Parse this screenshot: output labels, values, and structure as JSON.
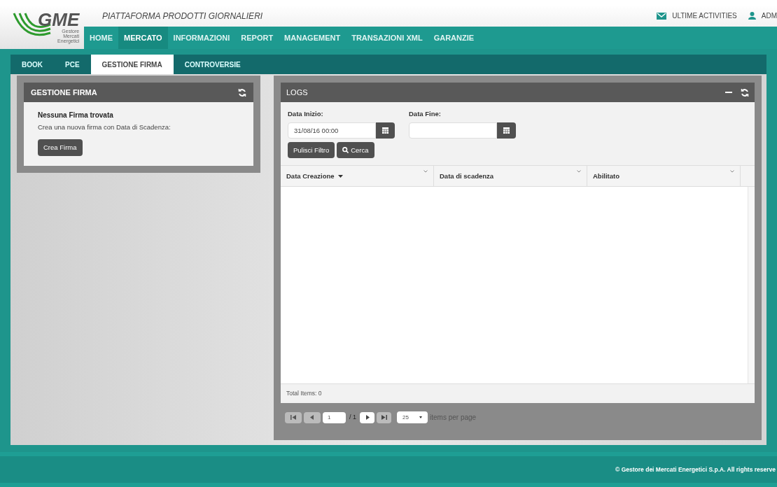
{
  "header": {
    "logo": {
      "name": "GME",
      "subtitle": [
        "Gestore",
        "Mercati",
        "Energetici"
      ]
    },
    "title": "PIATTAFORMA PRODOTTI GIORNALIERI",
    "links": [
      {
        "kind": "mail",
        "label": "ULTIME ACTIVITIES"
      },
      {
        "kind": "user",
        "label": "ADM"
      }
    ]
  },
  "nav": [
    {
      "label": "HOME",
      "selected": false
    },
    {
      "label": "MERCATO",
      "selected": true
    },
    {
      "label": "INFORMAZIONI",
      "selected": false
    },
    {
      "label": "REPORT",
      "selected": false
    },
    {
      "label": "MANAGEMENT",
      "selected": false
    },
    {
      "label": "TRANSAZIONI XML",
      "selected": false
    },
    {
      "label": "GARANZIE",
      "selected": false
    }
  ],
  "tabs": [
    {
      "label": "BOOK",
      "selected": false
    },
    {
      "label": "PCE",
      "selected": false
    },
    {
      "label": "GESTIONE FIRMA",
      "selected": true
    },
    {
      "label": "CONTROVERSIE",
      "selected": false
    }
  ],
  "firma_panel": {
    "title": "GESTIONE FIRMA",
    "heading": "Nessuna Firma trovata",
    "text": "Crea una nuova firma con Data di Scadenza:",
    "button": "Crea Firma"
  },
  "logs_panel": {
    "title": "LOGS",
    "filters": [
      {
        "label": "Data Inizio:",
        "value": "31/08/16 00:00"
      },
      {
        "label": "Data Fine:"
      }
    ],
    "buttons": [
      {
        "label": "Pulisci Filtro",
        "kind": "plain"
      },
      {
        "label": "Cerca",
        "kind": "search"
      }
    ],
    "columns": [
      {
        "label": "Data Creazione",
        "sorted": true
      },
      {
        "label": "Data di scadenza",
        "sorted": false
      },
      {
        "label": "Abilitato",
        "sorted": false
      }
    ],
    "total": "Total Items: 0",
    "pager": {
      "page": "1",
      "of": "/ 1",
      "page_size": "25",
      "per_page": "items per page"
    }
  },
  "footer": "© Gestore dei Mercati Energetici S.p.A. All rights reserve"
}
